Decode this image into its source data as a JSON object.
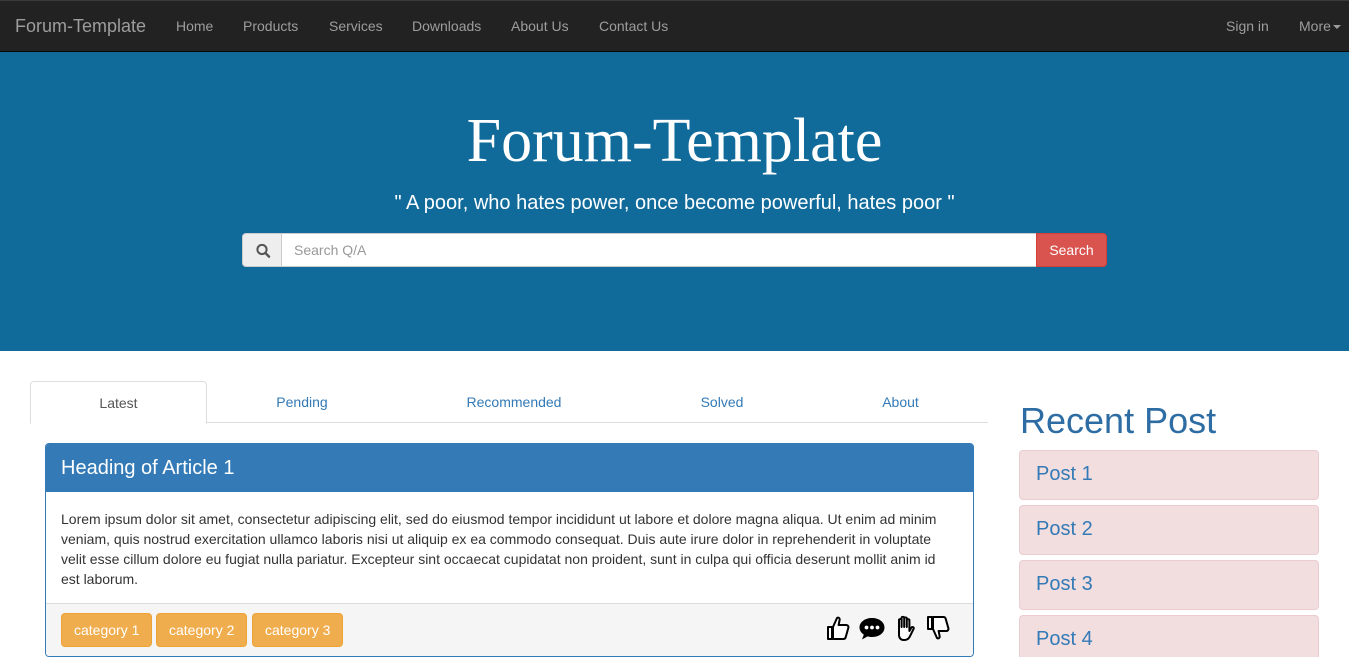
{
  "navbar": {
    "brand": "Forum-Template",
    "items": [
      {
        "label": "Home"
      },
      {
        "label": "Products"
      },
      {
        "label": "Services"
      },
      {
        "label": "Downloads"
      },
      {
        "label": "About Us"
      },
      {
        "label": "Contact Us"
      }
    ],
    "sign_in": "Sign in",
    "more": "More"
  },
  "hero": {
    "title": "Forum-Template",
    "quote": "\" A poor, who hates power, once become powerful, hates poor \"",
    "search": {
      "placeholder": "Search Q/A",
      "value": "",
      "button_label": "Search",
      "icon": "search-icon"
    }
  },
  "tabs": [
    {
      "label": "Latest",
      "active": true
    },
    {
      "label": "Pending",
      "active": false
    },
    {
      "label": "Recommended",
      "active": false
    },
    {
      "label": "Solved",
      "active": false
    },
    {
      "label": "About",
      "active": false
    }
  ],
  "article": {
    "heading": "Heading of Article 1",
    "body": "Lorem ipsum dolor sit amet, consectetur adipiscing elit, sed do eiusmod tempor incididunt ut labore et dolore magna aliqua. Ut enim ad minim veniam, quis nostrud exercitation ullamco laboris nisi ut aliquip ex ea commodo consequat. Duis aute irure dolor in reprehenderit in voluptate velit esse cillum dolore eu fugiat nulla pariatur. Excepteur sint occaecat cupidatat non proident, sunt in culpa qui officia deserunt mollit anim id est laborum.",
    "categories": [
      "category 1",
      "category 2",
      "category 3"
    ],
    "actions": [
      "thumbs-up-icon",
      "comment-icon",
      "raised-hand-icon",
      "thumbs-down-icon"
    ]
  },
  "sidebar": {
    "title": "Recent Post",
    "posts": [
      "Post 1",
      "Post 2",
      "Post 3",
      "Post 4"
    ]
  },
  "colors": {
    "navbar_bg": "#222222",
    "hero_bg": "#106b9b",
    "primary": "#337ab7",
    "danger": "#d9534f",
    "warning": "#f0ad4e",
    "post_bg": "#f2dede"
  }
}
